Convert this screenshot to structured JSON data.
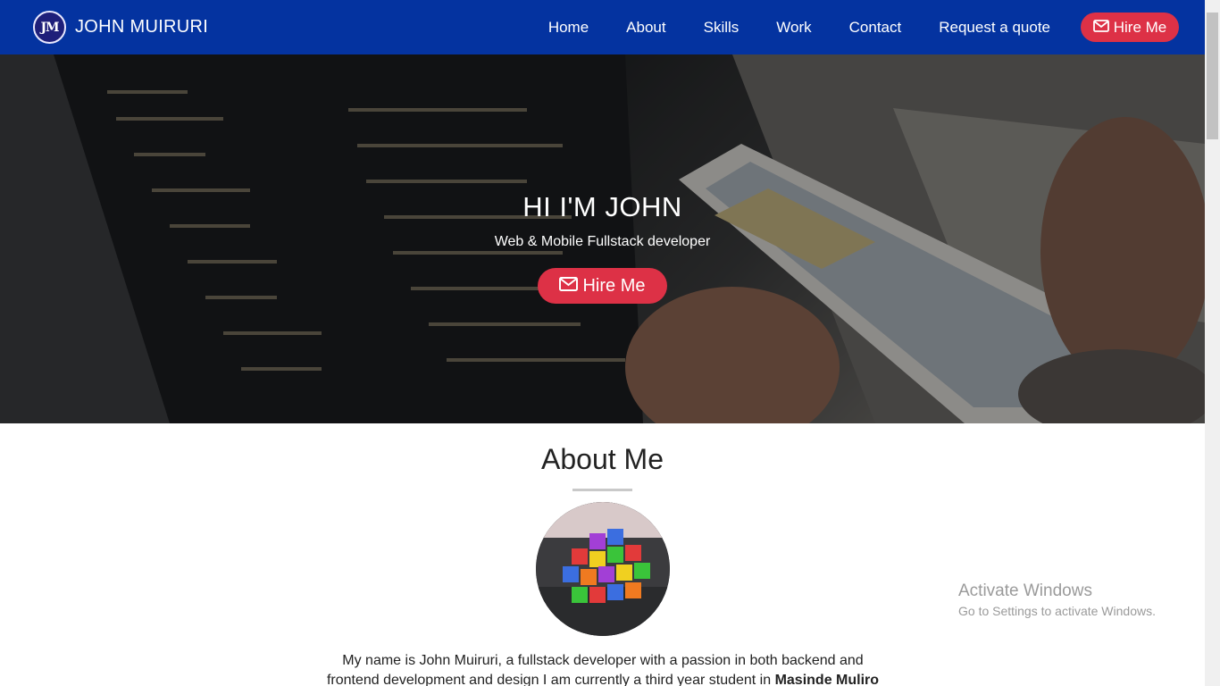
{
  "nav": {
    "logo_text": "JM",
    "brand": "JOHN MUIRURI",
    "links": [
      "Home",
      "About",
      "Skills",
      "Work",
      "Contact",
      "Request a quote"
    ],
    "hire_button": "Hire Me",
    "background": "#0433a0",
    "accent": "#dd3146"
  },
  "hero": {
    "title": "HI I'M JOHN",
    "subtitle": "Web & Mobile Fullstack developer",
    "button": "Hire Me"
  },
  "about": {
    "title": "About Me",
    "text_start": "My name is John Muiruri, a fullstack developer with a passion in both backend and frontend development and design I am currently a third year student in ",
    "text_bold": "Masinde Muliro"
  },
  "watermark": {
    "title": "Activate Windows",
    "subtitle": "Go to Settings to activate Windows."
  },
  "icons": {
    "envelope": "envelope-icon"
  }
}
